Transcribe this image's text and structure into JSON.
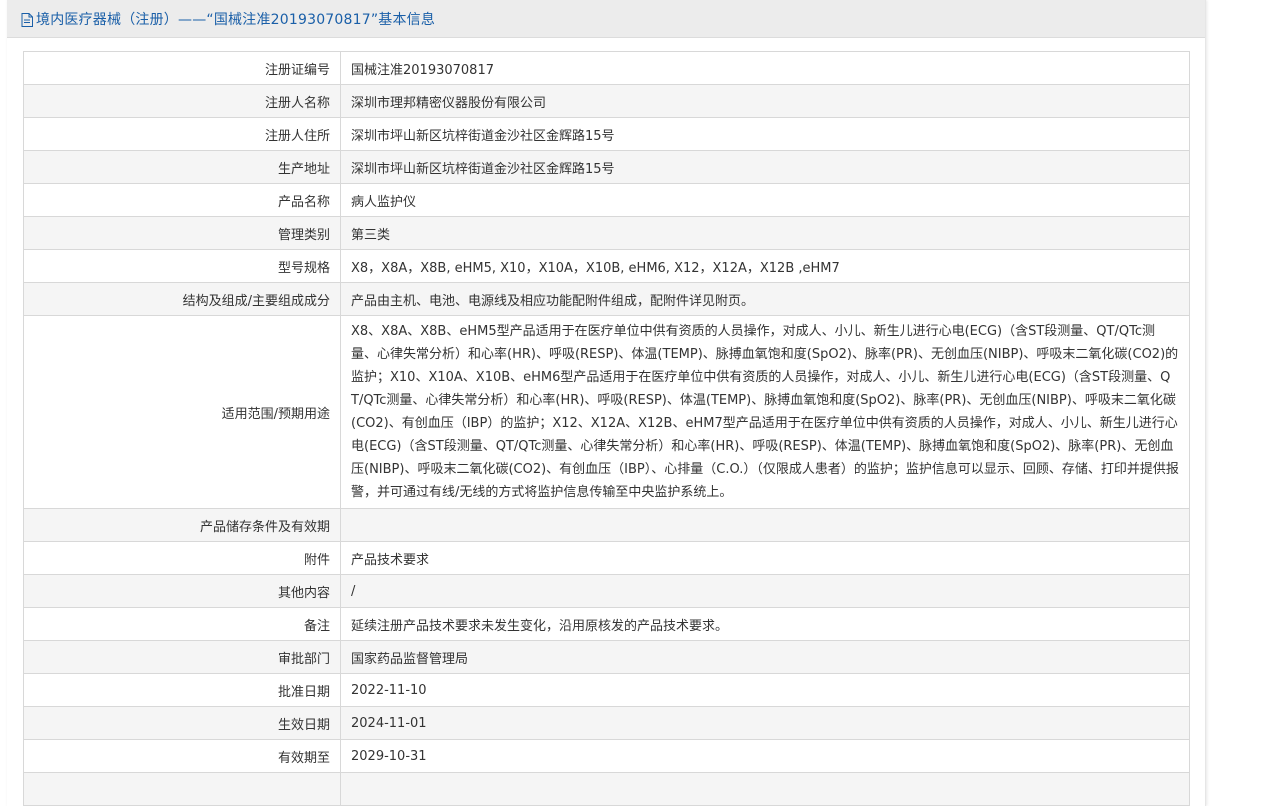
{
  "header": {
    "title": "境内医疗器械（注册）——“国械注准20193070817”基本信息",
    "icon": "document-icon",
    "accent_color": "#1a5fa8"
  },
  "rows": [
    {
      "label": "注册证编号",
      "value": "国械注准20193070817"
    },
    {
      "label": "注册人名称",
      "value": "深圳市理邦精密仪器股份有限公司"
    },
    {
      "label": "注册人住所",
      "value": "深圳市坪山新区坑梓街道金沙社区金辉路15号"
    },
    {
      "label": "生产地址",
      "value": "深圳市坪山新区坑梓街道金沙社区金辉路15号"
    },
    {
      "label": "产品名称",
      "value": "病人监护仪"
    },
    {
      "label": "管理类别",
      "value": "第三类"
    },
    {
      "label": "型号规格",
      "value": "X8，X8A，X8B, eHM5, X10，X10A，X10B, eHM6, X12，X12A，X12B ,eHM7"
    },
    {
      "label": "结构及组成/主要组成成分",
      "value": "产品由主机、电池、电源线及相应功能配附件组成，配附件详见附页。"
    },
    {
      "label": "适用范围/预期用途",
      "value": "X8、X8A、X8B、eHM5型产品适用于在医疗单位中供有资质的人员操作，对成人、小儿、新生儿进行心电(ECG)（含ST段测量、QT/QTc测量、心律失常分析）和心率(HR)、呼吸(RESP)、体温(TEMP)、脉搏血氧饱和度(SpO2)、脉率(PR)、无创血压(NIBP)、呼吸末二氧化碳(CO2)的监护；X10、X10A、X10B、eHM6型产品适用于在医疗单位中供有资质的人员操作，对成人、小儿、新生儿进行心电(ECG)（含ST段测量、QT/QTc测量、心律失常分析）和心率(HR)、呼吸(RESP)、体温(TEMP)、脉搏血氧饱和度(SpO2)、脉率(PR)、无创血压(NIBP)、呼吸末二氧化碳(CO2)、有创血压（IBP）的监护；X12、X12A、X12B、eHM7型产品适用于在医疗单位中供有资质的人员操作，对成人、小儿、新生儿进行心电(ECG)（含ST段测量、QT/QTc测量、心律失常分析）和心率(HR)、呼吸(RESP)、体温(TEMP)、脉搏血氧饱和度(SpO2)、脉率(PR)、无创血压(NIBP)、呼吸末二氧化碳(CO2)、有创血压（IBP）、心排量（C.O.）（仅限成人患者）的监护；监护信息可以显示、回顾、存储、打印并提供报警，并可通过有线/无线的方式将监护信息传输至中央监护系统上。"
    },
    {
      "label": "产品储存条件及有效期",
      "value": ""
    },
    {
      "label": "附件",
      "value": "产品技术要求"
    },
    {
      "label": "其他内容",
      "value": "/"
    },
    {
      "label": "备注",
      "value": "延续注册产品技术要求未发生变化，沿用原核发的产品技术要求。"
    },
    {
      "label": "审批部门",
      "value": "国家药品监督管理局"
    },
    {
      "label": "批准日期",
      "value": "2022-11-10"
    },
    {
      "label": "生效日期",
      "value": "2024-11-01"
    },
    {
      "label": "有效期至",
      "value": "2029-10-31"
    },
    {
      "label": "",
      "value": ""
    }
  ]
}
